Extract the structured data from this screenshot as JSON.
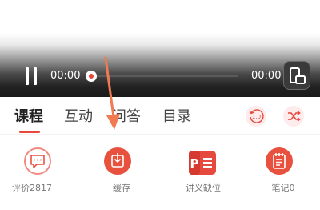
{
  "player": {
    "current_time": "00:00",
    "total_time": "00:00",
    "progress": 0,
    "icons": {
      "play_state": "pause-icon",
      "screen": "screen-toggle-icon"
    }
  },
  "tabs": [
    {
      "label": "课程",
      "active": true
    },
    {
      "label": "互动",
      "active": false
    },
    {
      "label": "问答",
      "active": false
    },
    {
      "label": "目录",
      "active": false
    }
  ],
  "controls": {
    "speed_icon": "playback-speed-icon",
    "speed_text": "1.0",
    "shuffle_icon": "shuffle-icon"
  },
  "actions": [
    {
      "label": "评价2817",
      "icon": "comment-icon"
    },
    {
      "label": "缓存",
      "icon": "download-icon"
    },
    {
      "label": "讲义缺位",
      "icon": "ppt-icon",
      "icon_text": "P"
    },
    {
      "label": "笔记0",
      "icon": "notes-icon"
    }
  ],
  "colors": {
    "accent": "#e8473b",
    "accent_light": "#fdeceb",
    "annotation_arrow": "#f07a52"
  }
}
